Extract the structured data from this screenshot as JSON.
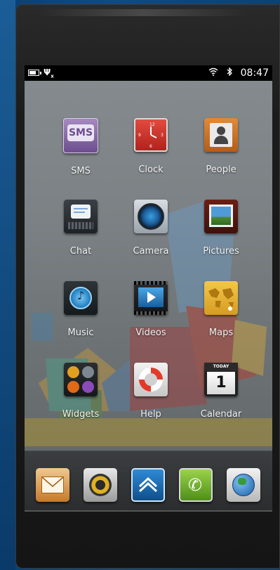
{
  "status_bar": {
    "time": "08:47",
    "battery_icon": "battery-icon",
    "signal_icon": "no-signal-icon",
    "wifi_icon": "wifi-icon",
    "bluetooth_icon": "bluetooth-icon"
  },
  "apps": [
    {
      "label": "SMS",
      "icon": "sms-icon",
      "badge_text": "SMS"
    },
    {
      "label": "Clock",
      "icon": "clock-icon"
    },
    {
      "label": "People",
      "icon": "people-icon"
    },
    {
      "label": "Chat",
      "icon": "chat-icon"
    },
    {
      "label": "Camera",
      "icon": "camera-icon"
    },
    {
      "label": "Pictures",
      "icon": "pictures-icon"
    },
    {
      "label": "Music",
      "icon": "music-icon"
    },
    {
      "label": "Videos",
      "icon": "videos-icon"
    },
    {
      "label": "Maps",
      "icon": "maps-icon"
    },
    {
      "label": "Widgets",
      "icon": "widgets-icon"
    },
    {
      "label": "Help",
      "icon": "help-icon"
    },
    {
      "label": "Calendar",
      "icon": "calendar-icon",
      "badge_top": "TODAY",
      "badge_day": "1"
    }
  ],
  "dock": [
    {
      "icon": "mail-icon"
    },
    {
      "icon": "settings-icon"
    },
    {
      "icon": "launcher-icon"
    },
    {
      "icon": "phone-icon"
    },
    {
      "icon": "browser-icon"
    }
  ],
  "colors": {
    "sms": "#8a6aa8",
    "clock": "#c8322c",
    "people": "#c46a22",
    "maps": "#e3b23c",
    "launcher": "#1d6fb0",
    "phone": "#6fb52c"
  }
}
